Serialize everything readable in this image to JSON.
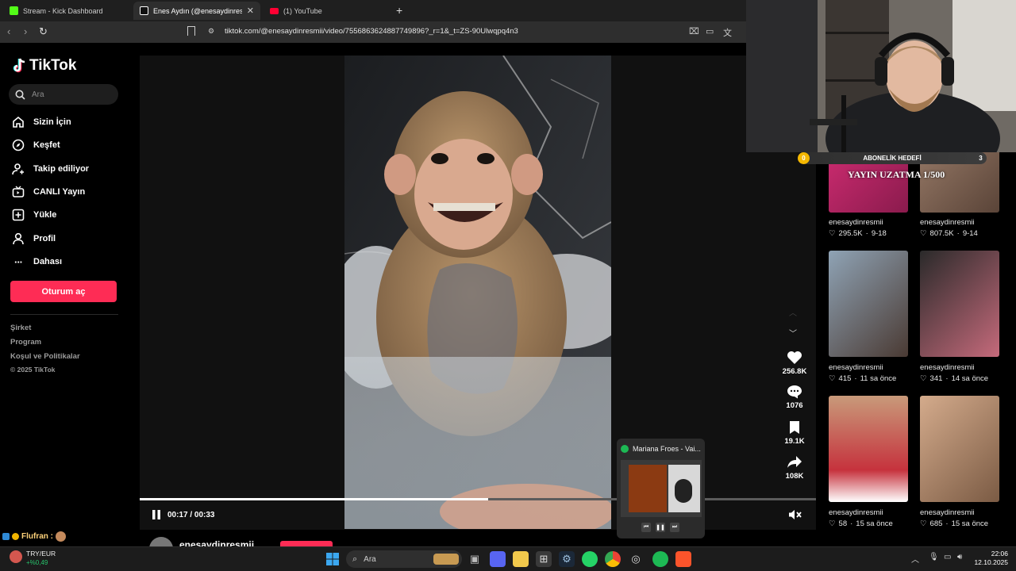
{
  "browser": {
    "tabs": [
      {
        "label": "Stream - Kick Dashboard",
        "favicon_color": "#53fc18"
      },
      {
        "label": "Enes Aydın (@enesaydinresmii) |",
        "favicon_color": "#ffffff"
      },
      {
        "label": "(1) YouTube",
        "favicon_color": "#ff0033"
      }
    ],
    "url": "tiktok.com/@enesaydinresmii/video/7556863624887749896?_r=1&_t=ZS-90Ulwqpq4n3"
  },
  "tiktok": {
    "logo_text": "TikTok",
    "search_placeholder": "Ara",
    "nav": [
      {
        "label": "Sizin İçin",
        "icon": "home-icon"
      },
      {
        "label": "Keşfet",
        "icon": "compass-icon"
      },
      {
        "label": "Takip ediliyor",
        "icon": "following-icon"
      },
      {
        "label": "CANLI Yayın",
        "icon": "live-icon"
      },
      {
        "label": "Yükle",
        "icon": "upload-icon"
      },
      {
        "label": "Profil",
        "icon": "profile-icon"
      },
      {
        "label": "Dahası",
        "icon": "more-icon"
      }
    ],
    "login_label": "Oturum aç",
    "footer": [
      "Şirket",
      "Program",
      "Koşul ve Politikalar",
      "© 2025 TikTok"
    ],
    "player": {
      "time": "00:17 / 00:33",
      "progress": 0.515
    },
    "actions": {
      "likes": "256.8K",
      "comments": "1076",
      "saves": "19.1K",
      "shares": "108K"
    },
    "username_below": "enesaydinresmii",
    "grid": [
      {
        "user": "enesaydinresmii",
        "likes": "295.5K",
        "when": "9-18",
        "color": "#c2185b"
      },
      {
        "user": "enesaydinresmii",
        "likes": "807.5K",
        "when": "9-14",
        "color": "#8d6e63"
      },
      {
        "user": "enesaydinresmii",
        "likes": "415",
        "when": "11 sa önce",
        "color": "#6d7f8f"
      },
      {
        "user": "enesaydinresmii",
        "likes": "341",
        "when": "14 sa önce",
        "color": "#3a3a3a"
      },
      {
        "user": "enesaydinresmii",
        "likes": "58",
        "when": "15 sa önce",
        "color": "#b07a5a"
      },
      {
        "user": "enesaydinresmii",
        "likes": "685",
        "when": "15 sa önce",
        "color": "#a9856a"
      }
    ]
  },
  "overlay": {
    "sub_goal_label": "ABONELİK HEDEFİ",
    "sub_goal_current": "0",
    "sub_goal_target": "3",
    "uzatma": "YAYIN UZATMA 1/500",
    "chat_user": "Flufran :"
  },
  "spotify": {
    "title": "Mariana Froes - Vai..."
  },
  "taskbar": {
    "ticker": "TRY/EUR",
    "ticker_change": "+%0,49",
    "search_placeholder": "Ara",
    "time": "22:06",
    "date": "12.10.2025"
  }
}
